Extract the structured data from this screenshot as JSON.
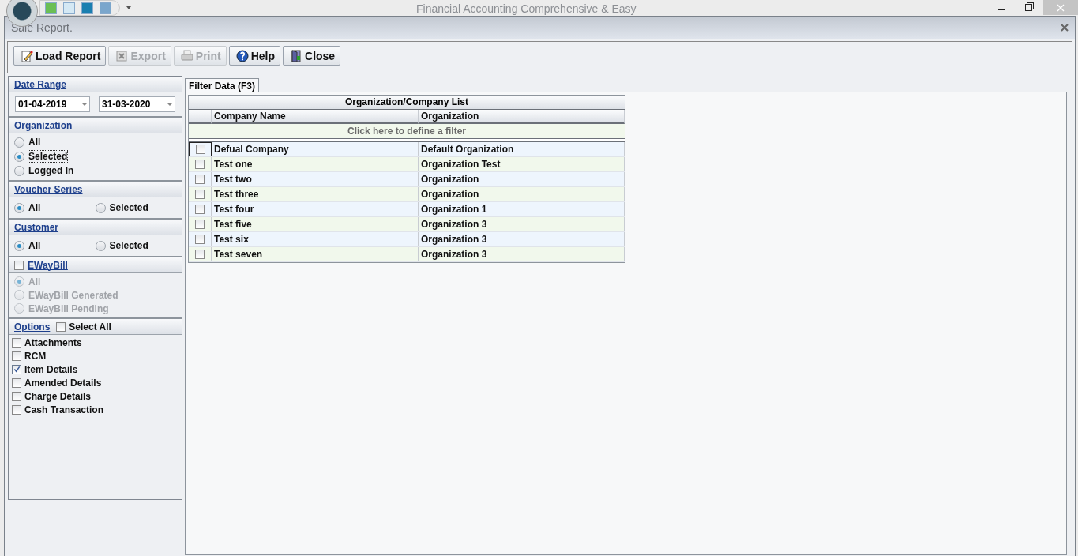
{
  "app": {
    "title": "Financial Accounting Comprehensive & Easy"
  },
  "window": {
    "title": "Sale Report."
  },
  "toolbar": [
    {
      "label": "Load Report",
      "disabled": false
    },
    {
      "label": "Export",
      "disabled": true
    },
    {
      "label": "Print",
      "disabled": true
    },
    {
      "label": "Help",
      "disabled": false
    },
    {
      "label": "Close",
      "disabled": false
    }
  ],
  "date_range": {
    "title": "Date Range",
    "from": "01-04-2019",
    "to": "31-03-2020"
  },
  "organization": {
    "title": "Organization",
    "options": [
      {
        "label": "All",
        "selected": false
      },
      {
        "label": "Selected",
        "selected": true
      },
      {
        "label": "Logged In",
        "selected": false
      }
    ]
  },
  "voucher_series": {
    "title": "Voucher Series",
    "options": [
      {
        "label": "All",
        "selected": true
      },
      {
        "label": "Selected",
        "selected": false
      }
    ]
  },
  "customer": {
    "title": "Customer",
    "options": [
      {
        "label": "All",
        "selected": true
      },
      {
        "label": "Selected",
        "selected": false
      }
    ]
  },
  "eway_bill": {
    "title": "EWayBill",
    "checked": false,
    "options": [
      {
        "label": "All",
        "selected": true,
        "disabled": true
      },
      {
        "label": "EWayBill Generated",
        "selected": false,
        "disabled": true
      },
      {
        "label": "EWayBill Pending",
        "selected": false,
        "disabled": true
      }
    ]
  },
  "options": {
    "title": "Options",
    "select_all": {
      "label": "Select All",
      "checked": false
    },
    "items": [
      {
        "label": "Attachments",
        "checked": false
      },
      {
        "label": "RCM",
        "checked": false
      },
      {
        "label": "Item Details",
        "checked": true
      },
      {
        "label": "Amended Details",
        "checked": false
      },
      {
        "label": "Charge Details",
        "checked": false
      },
      {
        "label": "Cash Transaction",
        "checked": false
      }
    ]
  },
  "tabs": [
    {
      "label": "Filter Data (F3)",
      "selected": true
    }
  ],
  "grid": {
    "title": "Organization/Company List",
    "columns": [
      "Company Name",
      "Organization"
    ],
    "filter_row": "Click here to define a filter",
    "rows": [
      {
        "checked": false,
        "cells": [
          "Defual Company",
          "Default Organization"
        ]
      },
      {
        "checked": false,
        "cells": [
          "Test one",
          "Organization Test"
        ]
      },
      {
        "checked": false,
        "cells": [
          "Test two",
          "Organization"
        ]
      },
      {
        "checked": false,
        "cells": [
          "Test three",
          "Organization"
        ]
      },
      {
        "checked": false,
        "cells": [
          "Test four",
          "Organization 1"
        ]
      },
      {
        "checked": false,
        "cells": [
          "Test five",
          "Organization 3"
        ]
      },
      {
        "checked": false,
        "cells": [
          "Test six",
          "Organization 3"
        ]
      },
      {
        "checked": false,
        "cells": [
          "Test seven",
          "Organization 3"
        ]
      }
    ]
  }
}
